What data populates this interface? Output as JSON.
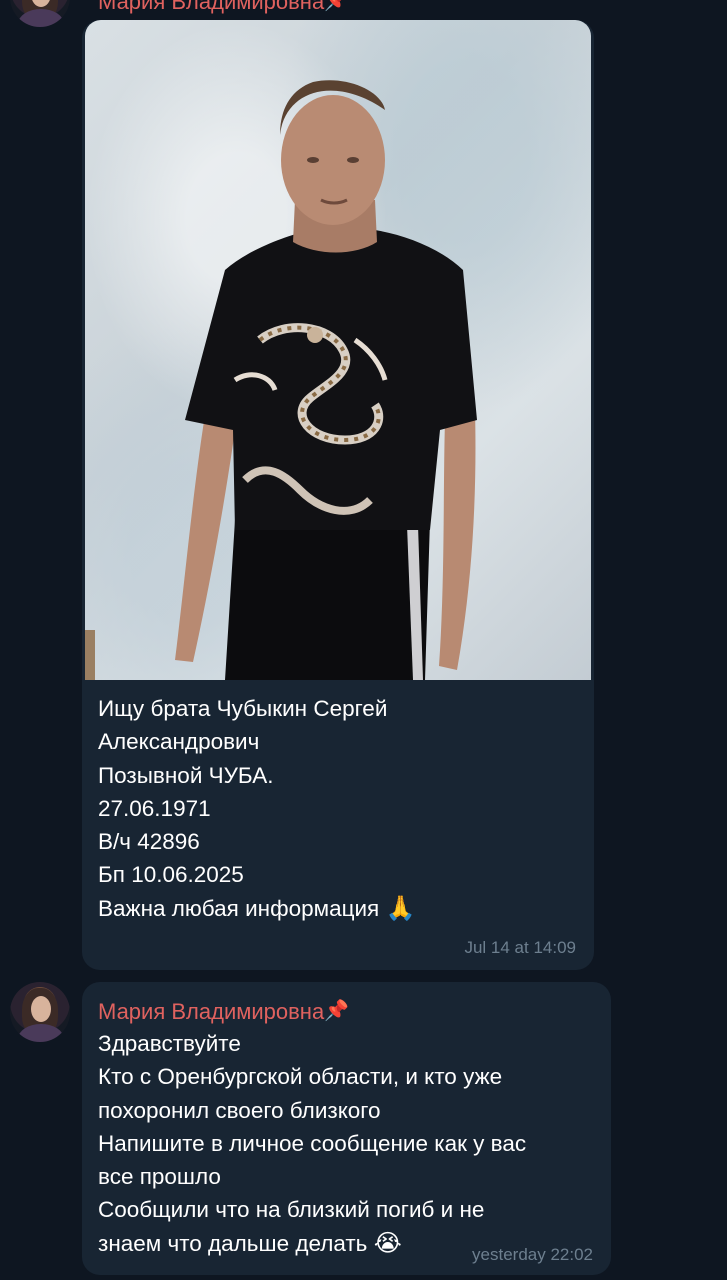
{
  "messages": [
    {
      "sender": "Мария Владимировна",
      "sender_suffix_icon": "pushpin-icon",
      "has_photo": true,
      "lines": [
        "Ищу брата Чубыкин Сергей",
        "Александрович",
        "Позывной ЧУБА.",
        "27.06.1971",
        "В/ч 42896",
        "Бп 10.06.2025",
        "Важна любая информация"
      ],
      "trailing_emoji": "🙏",
      "time": "Jul 14 at 14:09"
    },
    {
      "sender": "Мария Владимировна",
      "sender_suffix_icon": "pushpin-icon",
      "lines": [
        "Здравствуйте",
        "Кто с Оренбургской области, и кто уже",
        "похоронил своего близкого",
        "Напишите в личное сообщение как у вас",
        "все прошло",
        "Сообщили что на близкий погиб и не",
        "знаем что дальше делать"
      ],
      "trailing_emoji": "😭",
      "time": "yesterday 22:02"
    }
  ],
  "pin_glyph": "📌",
  "colors": {
    "background": "#0e1621",
    "bubble": "#182533",
    "sender_name": "#e0625f",
    "timestamp": "#6d7f8f",
    "text": "#ffffff"
  }
}
